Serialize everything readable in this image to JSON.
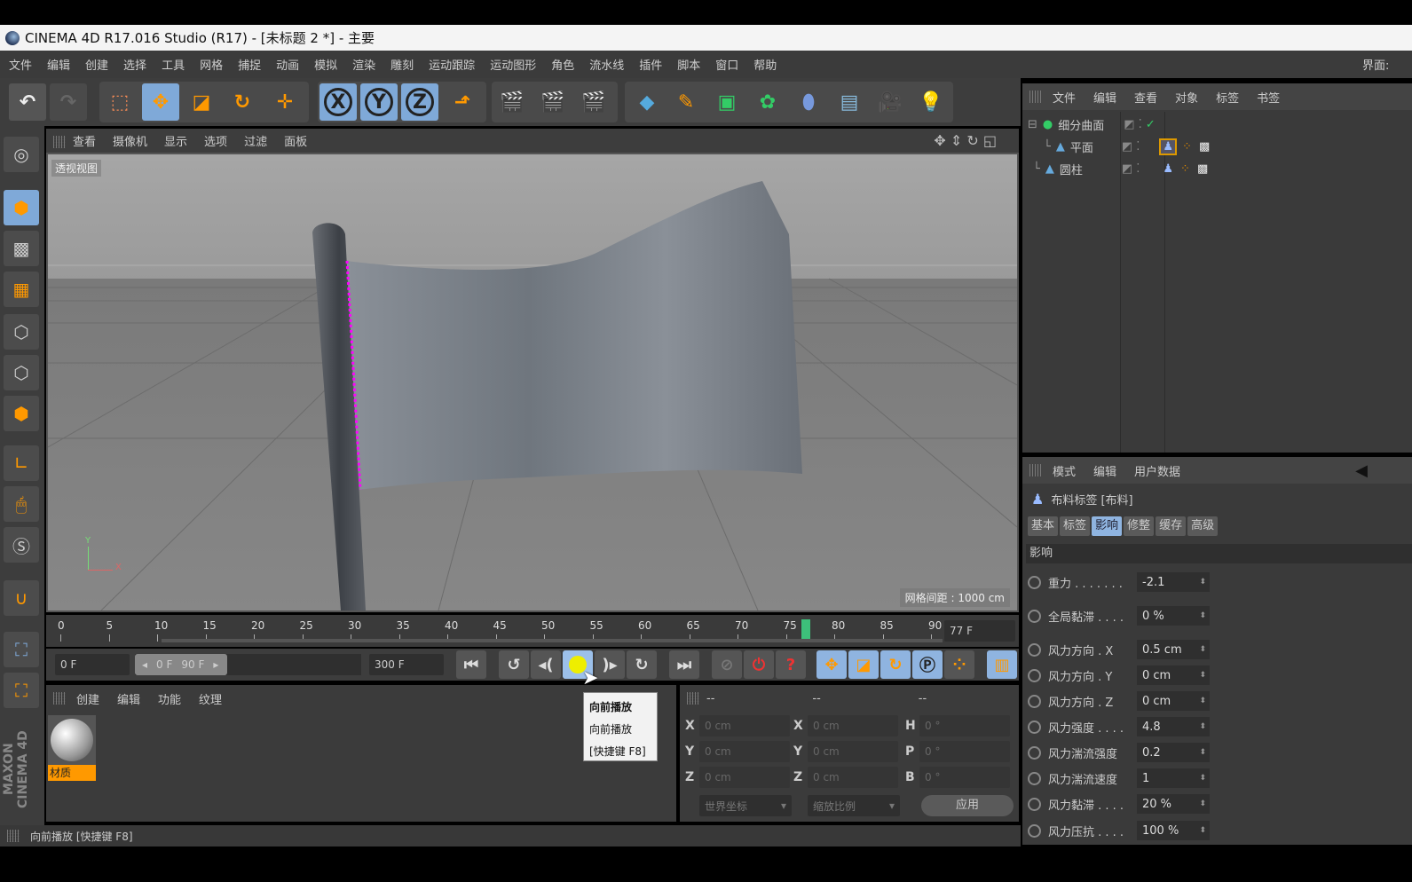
{
  "window": {
    "title": "CINEMA 4D R17.016 Studio (R17) - [未标题 2 *] - 主要",
    "layout_label": "界面:"
  },
  "menu": [
    "文件",
    "编辑",
    "创建",
    "选择",
    "工具",
    "网格",
    "捕捉",
    "动画",
    "模拟",
    "渲染",
    "雕刻",
    "运动跟踪",
    "运动图形",
    "角色",
    "流水线",
    "插件",
    "脚本",
    "窗口",
    "帮助"
  ],
  "toolbar": {
    "axis": [
      "X",
      "Y",
      "Z"
    ]
  },
  "viewport": {
    "menu": [
      "查看",
      "摄像机",
      "显示",
      "选项",
      "过滤",
      "面板"
    ],
    "label": "透视视图",
    "grid_spacing": "网格间距 : 1000 cm",
    "axis_y": "Y",
    "axis_x": "X"
  },
  "timeline": {
    "ticks": [
      "0",
      "5",
      "10",
      "15",
      "20",
      "25",
      "30",
      "35",
      "40",
      "45",
      "50",
      "55",
      "60",
      "65",
      "70",
      "75",
      "80",
      "85",
      "90"
    ],
    "current_frame": "77 F",
    "current_value": 77,
    "max": 90
  },
  "playback": {
    "start": "0 F",
    "range_start": "0 F",
    "range_end": "90 F",
    "end": "300 F"
  },
  "material_manager": {
    "menu": [
      "创建",
      "编辑",
      "功能",
      "纹理"
    ],
    "materials": [
      {
        "name": "材质"
      }
    ]
  },
  "coordinates": {
    "headers": [
      "--",
      "--",
      "--"
    ],
    "rows": [
      {
        "l1": "X",
        "v1": "0 cm",
        "l2": "X",
        "v2": "0 cm",
        "l3": "H",
        "v3": "0 °"
      },
      {
        "l1": "Y",
        "v1": "0 cm",
        "l2": "Y",
        "v2": "0 cm",
        "l3": "P",
        "v3": "0 °"
      },
      {
        "l1": "Z",
        "v1": "0 cm",
        "l2": "Z",
        "v2": "0 cm",
        "l3": "B",
        "v3": "0 °"
      }
    ],
    "mode": "世界坐标",
    "scale": "缩放比例",
    "apply": "应用"
  },
  "tooltip": {
    "title": "向前播放",
    "desc": "向前播放",
    "shortcut": "[快捷键 F8]"
  },
  "status": "向前播放 [快捷键 F8]",
  "object_manager": {
    "menu": [
      "文件",
      "编辑",
      "查看",
      "对象",
      "标签",
      "书签"
    ],
    "objects": [
      {
        "name": "细分曲面"
      },
      {
        "name": "平面"
      },
      {
        "name": "圆柱"
      }
    ]
  },
  "attributes": {
    "menu": [
      "模式",
      "编辑",
      "用户数据"
    ],
    "title": "布料标签 [布料]",
    "tabs": [
      "基本",
      "标签",
      "影响",
      "修整",
      "缓存",
      "高级"
    ],
    "active_tab": "影响",
    "section": "影响",
    "params": [
      {
        "label": "重力 . . . . . . .",
        "value": "-2.1"
      },
      {
        "label": "全局黏滞 . . . .",
        "value": "0 %"
      },
      {
        "label": "风力方向 . X",
        "value": "0.5 cm"
      },
      {
        "label": "风力方向 . Y",
        "value": "0 cm"
      },
      {
        "label": "风力方向 . Z",
        "value": "0 cm"
      },
      {
        "label": "风力强度 . . . .",
        "value": "4.8"
      },
      {
        "label": "风力湍流强度",
        "value": "0.2"
      },
      {
        "label": "风力湍流速度",
        "value": "1"
      },
      {
        "label": "风力黏滞 . . . .",
        "value": "20 %"
      },
      {
        "label": "风力压抗 . . . .",
        "value": "100 %"
      }
    ]
  }
}
